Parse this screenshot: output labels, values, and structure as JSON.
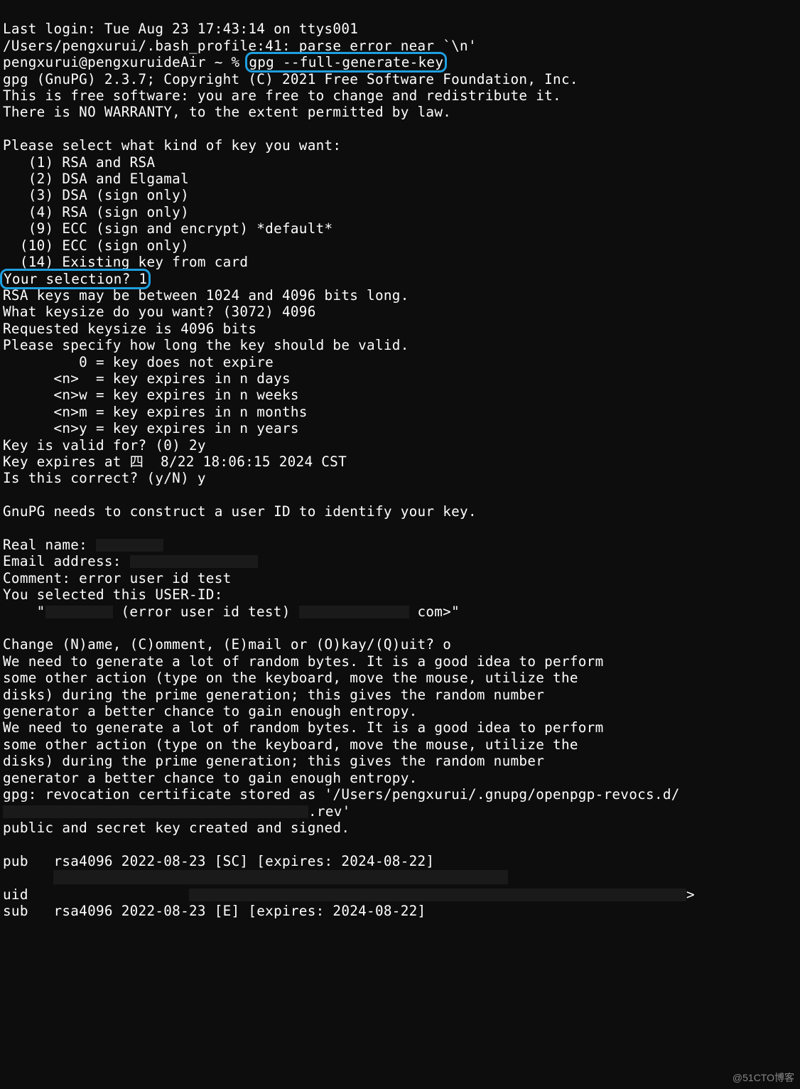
{
  "lastLogin": "Last login: Tue Aug 23 17:43:14 on ttys001",
  "bashErr": "/Users/pengxurui/.bash_profile:41: parse error near `\\n'",
  "promptUser": "pengxurui@pengxuruideAir ~ % ",
  "cmd": "gpg --full-generate-key",
  "banner": {
    "l1": "gpg (GnuPG) 2.3.7; Copyright (C) 2021 Free Software Foundation, Inc.",
    "l2": "This is free software: you are free to change and redistribute it.",
    "l3": "There is NO WARRANTY, to the extent permitted by law."
  },
  "selectPrompt": "Please select what kind of key you want:",
  "opts": {
    "o1": "   (1) RSA and RSA",
    "o2": "   (2) DSA and Elgamal",
    "o3": "   (3) DSA (sign only)",
    "o4": "   (4) RSA (sign only)",
    "o9": "   (9) ECC (sign and encrypt) *default*",
    "o10": "  (10) ECC (sign only)",
    "o14": "  (14) Existing key from card"
  },
  "yourSel": "Your selection? 1",
  "rsaRange": "RSA keys may be between 1024 and 4096 bits long.",
  "keysizeQ": "What keysize do you want? (3072) 4096",
  "reqSize": "Requested keysize is 4096 bits",
  "validPrompt": "Please specify how long the key should be valid.",
  "valid": {
    "v0": "         0 = key does not expire",
    "vn": "      <n>  = key expires in n days",
    "vw": "      <n>w = key expires in n weeks",
    "vm": "      <n>m = key expires in n months",
    "vy": "      <n>y = key expires in n years"
  },
  "keyValidFor": "Key is valid for? (0) 2y",
  "keyExpires": "Key expires at 四  8/22 18:06:15 2024 CST",
  "isCorrect": "Is this correct? (y/N) y",
  "needUid": "GnuPG needs to construct a user ID to identify your key.",
  "realNameLabel": "Real name: ",
  "emailLabel": "Email address: ",
  "commentLine": "Comment: error user id test",
  "youSelected": "You selected this USER-ID:",
  "uidMidText": " (error user id test) ",
  "uidTail": " com>\"",
  "changeQ": "Change (N)ame, (C)omment, (E)mail or (O)kay/(Q)uit? o",
  "entropy": {
    "e1": "We need to generate a lot of random bytes. It is a good idea to perform",
    "e2": "some other action (type on the keyboard, move the mouse, utilize the",
    "e3": "disks) during the prime generation; this gives the random number",
    "e4": "generator a better chance to gain enough entropy."
  },
  "revoc": "gpg: revocation certificate stored as '/Users/pengxurui/.gnupg/openpgp-revocs.d/",
  "revTail": ".rev'",
  "created": "public and secret key created and signed.",
  "pub": "pub   rsa4096 2022-08-23 [SC] [expires: 2024-08-22]",
  "uidLabel": "uid           ",
  "sub": "sub   rsa4096 2022-08-23 [E] [expires: 2024-08-22]",
  "credit": "@51CTO博客",
  "uidArrow": ">"
}
